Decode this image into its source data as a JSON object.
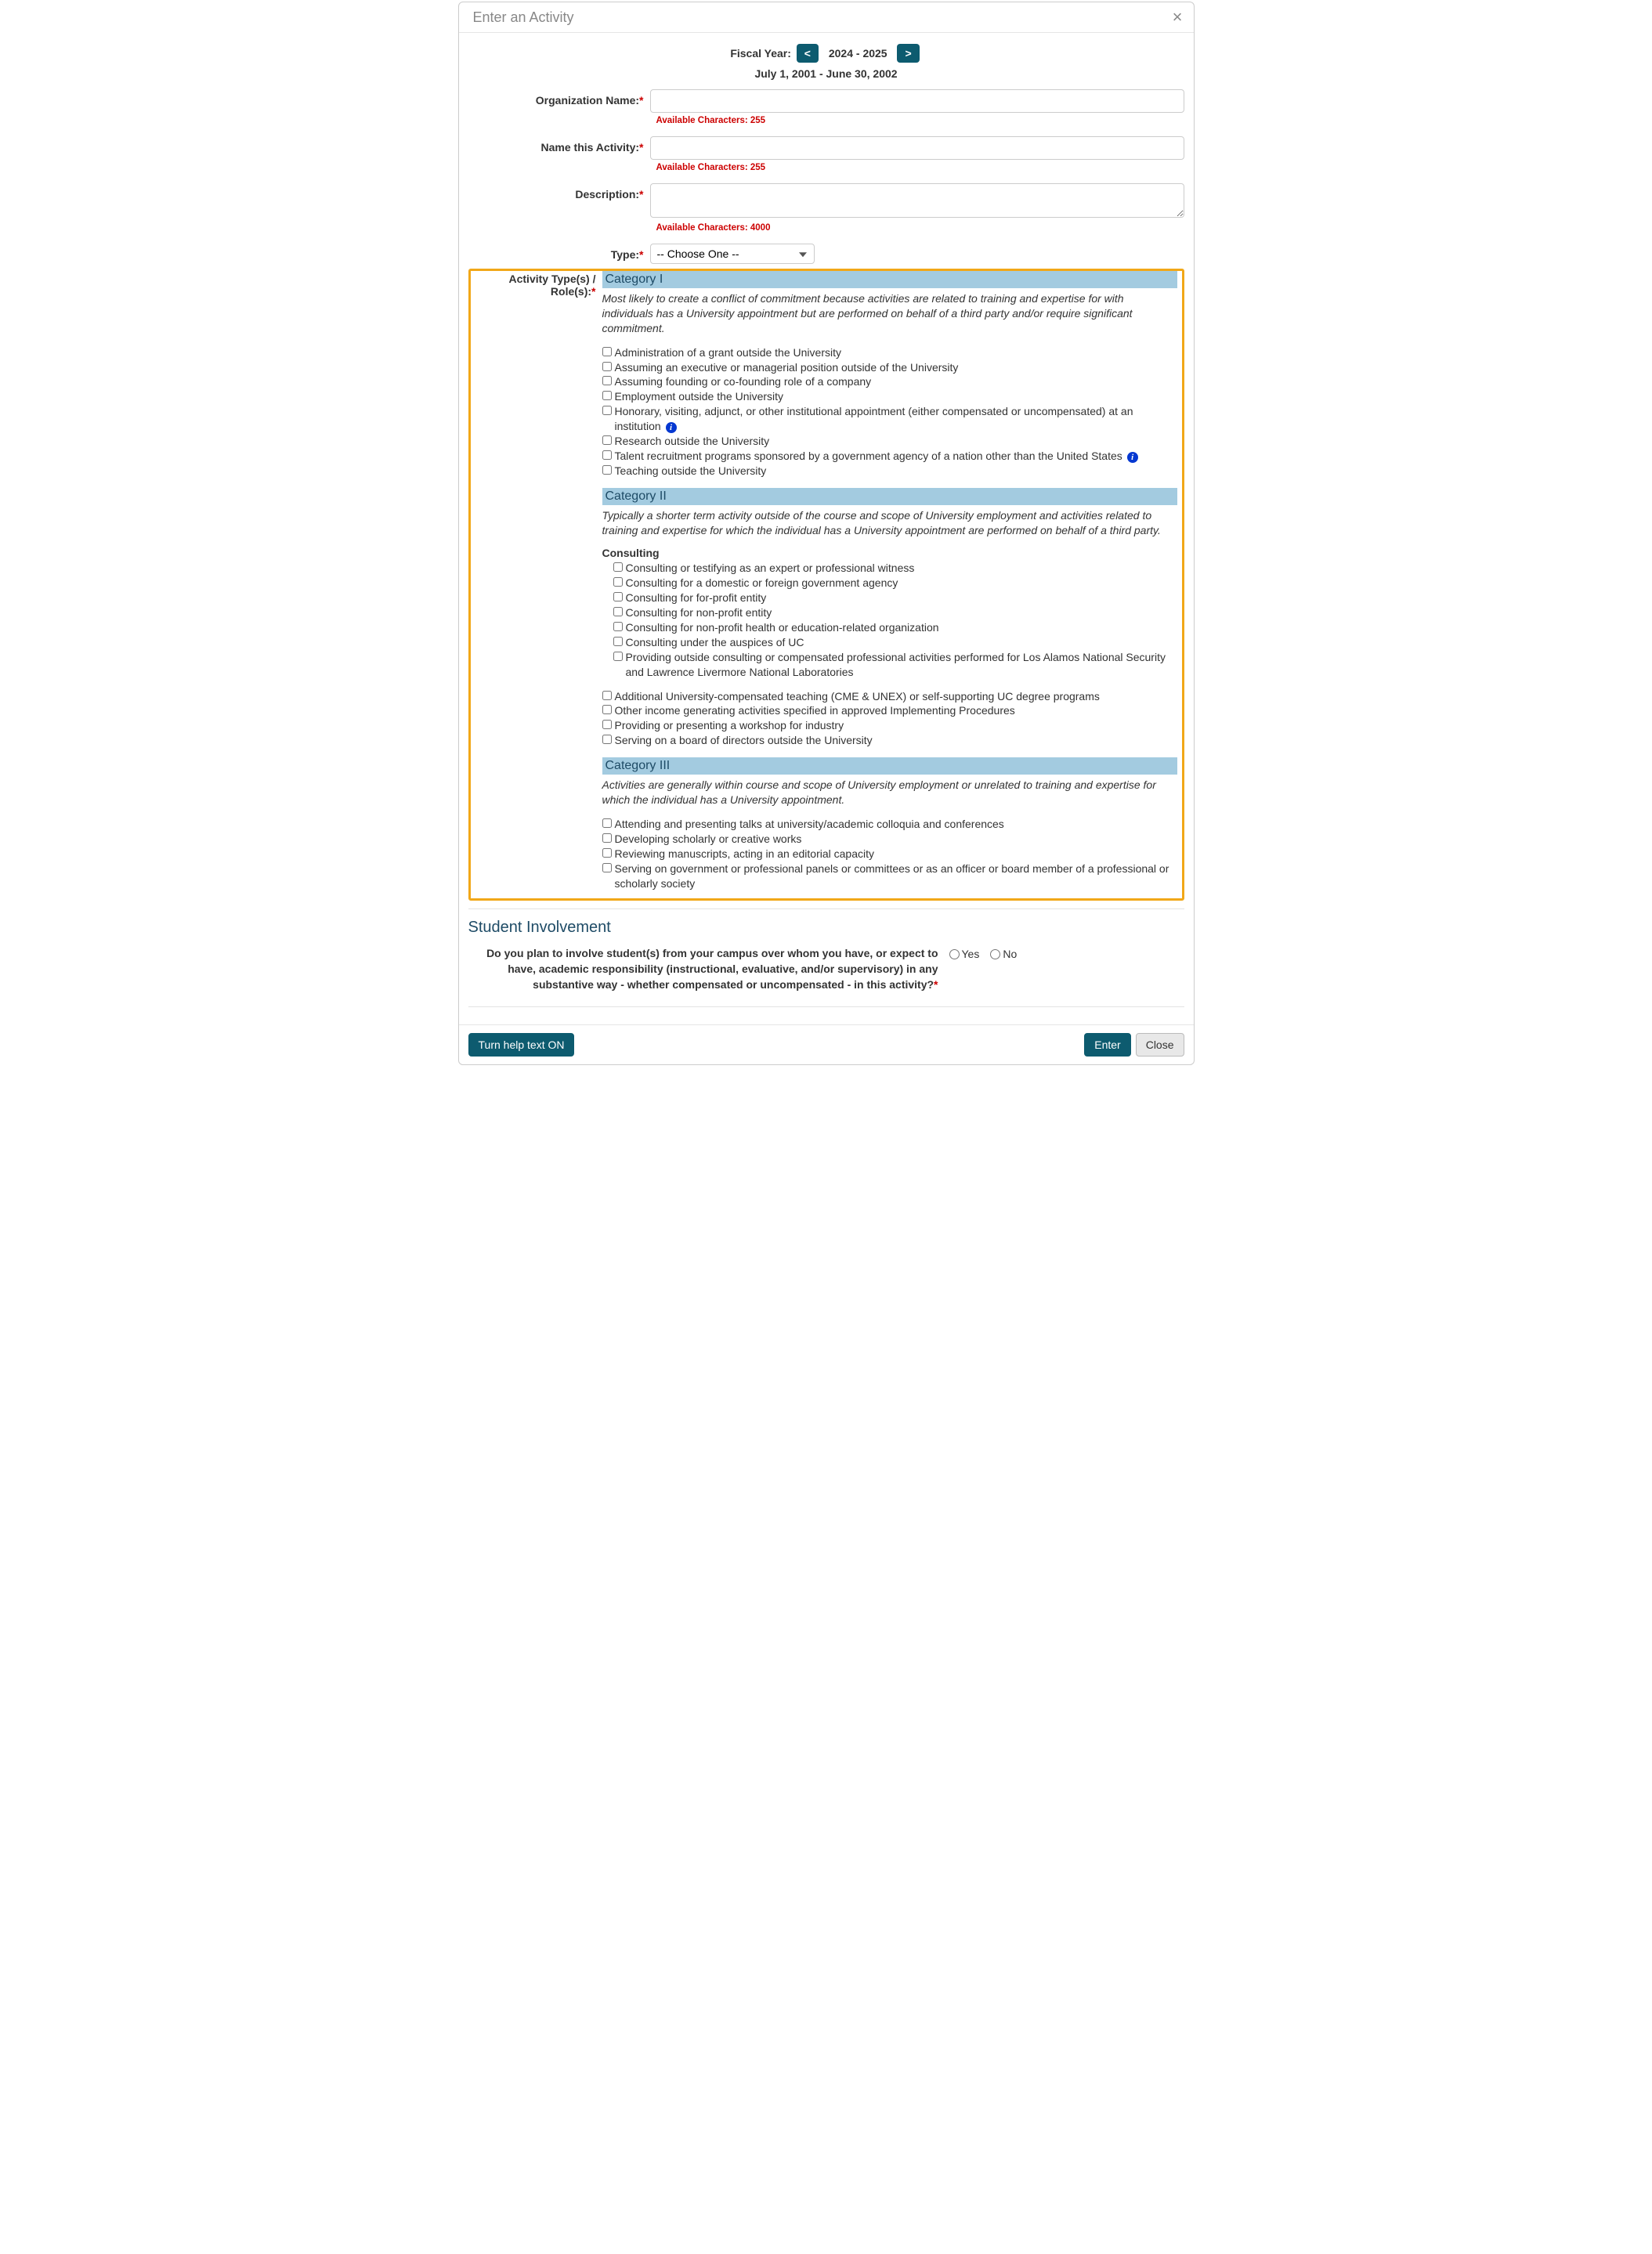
{
  "header": {
    "title": "Enter an Activity"
  },
  "fiscal": {
    "label": "Fiscal Year:",
    "prev": "<",
    "range": "2024 - 2025",
    "next": ">"
  },
  "dateRange": "July 1, 2001 - June 30, 2002",
  "labels": {
    "orgName": "Organization Name:",
    "activityName": "Name this Activity:",
    "description": "Description:",
    "type": "Type:",
    "activityTypes": "Activity Type(s) / Role(s):"
  },
  "charCounts": {
    "orgName": "Available Characters: 255",
    "activityName": "Available Characters: 255",
    "description": "Available Characters: 4000"
  },
  "typeSelect": {
    "placeholder": "-- Choose One --"
  },
  "categories": {
    "cat1": {
      "title": "Category I",
      "desc": "Most likely to create a conflict of commitment because activities are related to training and expertise for with individuals has a University appointment but are performed on behalf of a third party and/or require significant commitment.",
      "items": [
        "Administration of a grant outside the University",
        "Assuming an executive or managerial position outside of the University",
        "Assuming founding or co-founding role of a company",
        "Employment outside the University",
        "Honorary, visiting, adjunct, or other institutional appointment (either compensated or uncompensated) at an institution",
        "Research outside the University",
        "Talent recruitment programs sponsored by a government agency of a nation other than the United States",
        "Teaching outside the University"
      ],
      "infoAt": [
        4,
        6
      ]
    },
    "cat2": {
      "title": "Category II",
      "desc": "Typically a shorter term activity outside of the course and scope of University employment and activities related to training and expertise for which the individual has a University appointment are performed on behalf of a third party.",
      "consultingHeader": "Consulting",
      "consulting": [
        "Consulting or testifying as an expert or professional witness",
        "Consulting for a domestic or foreign government agency",
        "Consulting for for-profit entity",
        "Consulting for non-profit entity",
        "Consulting for non-profit health or education-related organization",
        "Consulting under the auspices of UC",
        "Providing outside consulting or compensated professional activities performed for Los Alamos National Security and Lawrence Livermore National Laboratories"
      ],
      "other": [
        "Additional University-compensated teaching (CME & UNEX) or self-supporting UC degree programs",
        "Other income generating activities specified in approved Implementing Procedures",
        "Providing or presenting a workshop for industry",
        "Serving on a board of directors outside the University"
      ]
    },
    "cat3": {
      "title": "Category III",
      "desc": "Activities are generally within course and scope of University employment or unrelated to training and expertise for which the individual has a University appointment.",
      "items": [
        "Attending and presenting talks at university/academic colloquia and conferences",
        "Developing scholarly or creative works",
        "Reviewing manuscripts, acting in an editorial capacity",
        "Serving on government or professional panels or committees or as an officer or board member of a professional or scholarly society"
      ]
    }
  },
  "student": {
    "sectionTitle": "Student Involvement",
    "question": "Do you plan to involve student(s) from your campus over whom you have, or expect to have, academic responsibility (instructional, evaluative, and/or supervisory) in any substantive way - whether compensated or uncompensated - in this activity?",
    "yes": "Yes",
    "no": "No"
  },
  "footer": {
    "helpText": "Turn help text ON",
    "enter": "Enter",
    "close": "Close"
  }
}
